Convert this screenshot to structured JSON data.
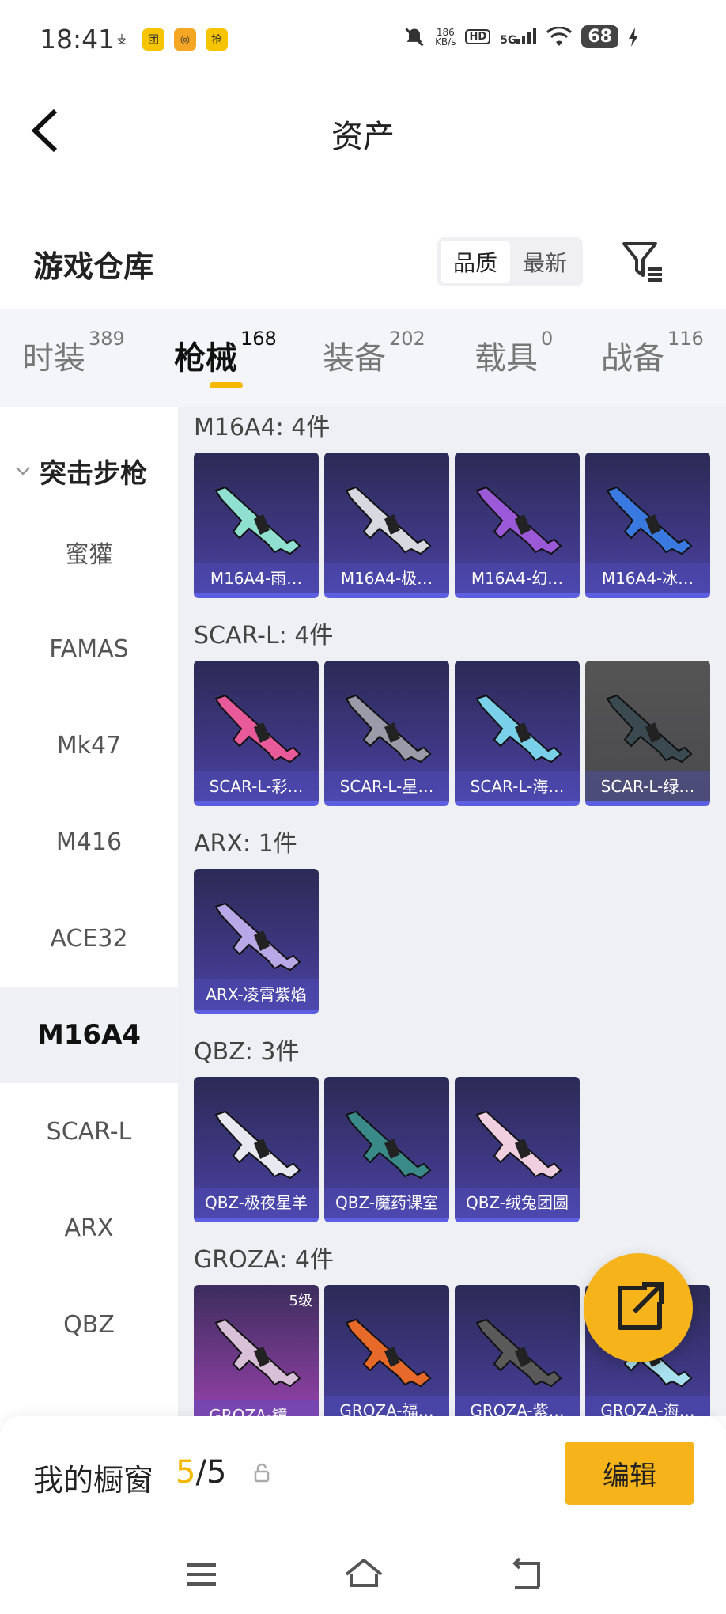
{
  "status_bar": {
    "time": "18:41",
    "app_icons": [
      "支",
      "团",
      "◎",
      "抢"
    ],
    "net_speed_value": "186",
    "net_speed_unit": "KB/s",
    "hd": "HD",
    "signal": "5G",
    "battery": "68"
  },
  "header": {
    "title": "资产"
  },
  "warehouse": {
    "title": "游戏仓库",
    "sort_options": [
      "品质",
      "最新"
    ],
    "active_sort": "品质"
  },
  "tabs": [
    {
      "label": "时装",
      "count": "389"
    },
    {
      "label": "枪械",
      "count": "168"
    },
    {
      "label": "装备",
      "count": "202"
    },
    {
      "label": "载具",
      "count": "0"
    },
    {
      "label": "战备",
      "count": "116"
    }
  ],
  "active_tab": "枪械",
  "sidebar": {
    "category": "突击步枪",
    "items": [
      "蜜獾",
      "FAMAS",
      "Mk47",
      "M416",
      "ACE32",
      "M16A4",
      "SCAR-L",
      "ARX",
      "QBZ"
    ],
    "active_item": "M16A4"
  },
  "groups": [
    {
      "title": "M16A4: 4件",
      "items": [
        {
          "name": "M16A4-雨…",
          "style": "purple",
          "gun_color": "#8fe0d0"
        },
        {
          "name": "M16A4-极…",
          "style": "purple",
          "gun_color": "#d8d8e0"
        },
        {
          "name": "M16A4-幻…",
          "style": "purple",
          "gun_color": "#9a5ad8"
        },
        {
          "name": "M16A4-冰…",
          "style": "purple",
          "gun_color": "#3a7ae0"
        }
      ]
    },
    {
      "title": "SCAR-L: 4件",
      "items": [
        {
          "name": "SCAR-L-彩…",
          "style": "purple",
          "gun_color": "#e85a9a"
        },
        {
          "name": "SCAR-L-星…",
          "style": "purple",
          "gun_color": "#9a9aa8"
        },
        {
          "name": "SCAR-L-海…",
          "style": "purple",
          "gun_color": "#7ad0e8"
        },
        {
          "name": "SCAR-L-绿…",
          "style": "gray",
          "gun_color": "#3a4a50"
        }
      ]
    },
    {
      "title": "ARX: 1件",
      "items": [
        {
          "name": "ARX-凌霄紫焰",
          "style": "purple",
          "gun_color": "#b8a8e8"
        }
      ]
    },
    {
      "title": "QBZ: 3件",
      "items": [
        {
          "name": "QBZ-极夜星羊",
          "style": "purple",
          "gun_color": "#e8e8f0"
        },
        {
          "name": "QBZ-魔药课室",
          "style": "purple",
          "gun_color": "#3a8a8a"
        },
        {
          "name": "QBZ-绒兔团圆",
          "style": "purple",
          "gun_color": "#f0d0e0"
        }
      ]
    },
    {
      "title": "GROZA: 4件",
      "items": [
        {
          "name": "GROZA-镜…",
          "style": "pink",
          "gun_color": "#d8c0d8",
          "level": "5级"
        },
        {
          "name": "GROZA-福…",
          "style": "purple",
          "gun_color": "#e86a2a"
        },
        {
          "name": "GROZA-紫…",
          "style": "purple",
          "gun_color": "#5a5a5a"
        },
        {
          "name": "GROZA-海…",
          "style": "purple",
          "gun_color": "#a8e0f0"
        }
      ]
    }
  ],
  "showcase": {
    "label": "我的橱窗",
    "used": "5",
    "separator": "/",
    "total": "5",
    "edit_label": "编辑"
  },
  "colors": {
    "accent": "#f7b41a",
    "card_border": "#5b5fe0"
  }
}
